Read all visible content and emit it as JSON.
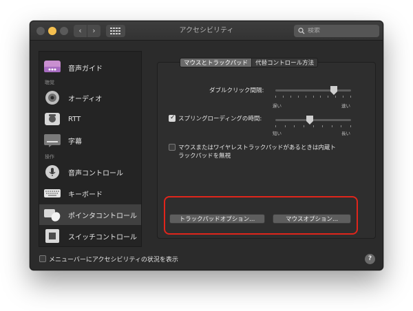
{
  "window": {
    "title": "アクセシビリティ"
  },
  "toolbar": {
    "back_symbol": "‹",
    "forward_symbol": "›",
    "search_placeholder": "検索"
  },
  "sidebar": {
    "items": [
      {
        "label": "音声ガイド",
        "icon": "voiceover-icon"
      },
      {
        "label": "オーディオ",
        "icon": "speaker-icon"
      },
      {
        "label": "RTT",
        "icon": "tty-icon"
      },
      {
        "label": "字幕",
        "icon": "captions-icon"
      },
      {
        "label": "音声コントロール",
        "icon": "voice-control-icon"
      },
      {
        "label": "キーボード",
        "icon": "keyboard-icon"
      },
      {
        "label": "ポインタコントロール",
        "icon": "pointer-control-icon",
        "selected": true
      },
      {
        "label": "スイッチコントロール",
        "icon": "switch-control-icon"
      }
    ],
    "headers": {
      "hearing": "聴覚",
      "interaction": "操作"
    }
  },
  "tabs": [
    {
      "label": "マウスとトラックパッド",
      "active": true
    },
    {
      "label": "代替コントロール方法",
      "active": false
    }
  ],
  "main": {
    "double_click_label": "ダブルクリック間隔:",
    "double_click_min": "遅い",
    "double_click_max": "速い",
    "double_click_value": 0.8,
    "spring_loading_label": "スプリングローディングの時間:",
    "spring_loading_checked": true,
    "spring_min": "短い",
    "spring_max": "長い",
    "spring_value": 0.45,
    "ignore_trackpad_label_1": "マウスまたはワイヤレストラックパッドがあるときは内蔵ト",
    "ignore_trackpad_label_2": "ラックパッドを無視",
    "ignore_trackpad_checked": false,
    "trackpad_options_button": "トラックパッドオプション...",
    "mouse_options_button": "マウスオプション..."
  },
  "footer": {
    "menubar_status_label": "メニューバーにアクセシビリティの状況を表示",
    "menubar_status_checked": false,
    "help_symbol": "?"
  },
  "colors": {
    "highlight": "#e1251b",
    "accent_yellow": "#f4bf4f"
  }
}
